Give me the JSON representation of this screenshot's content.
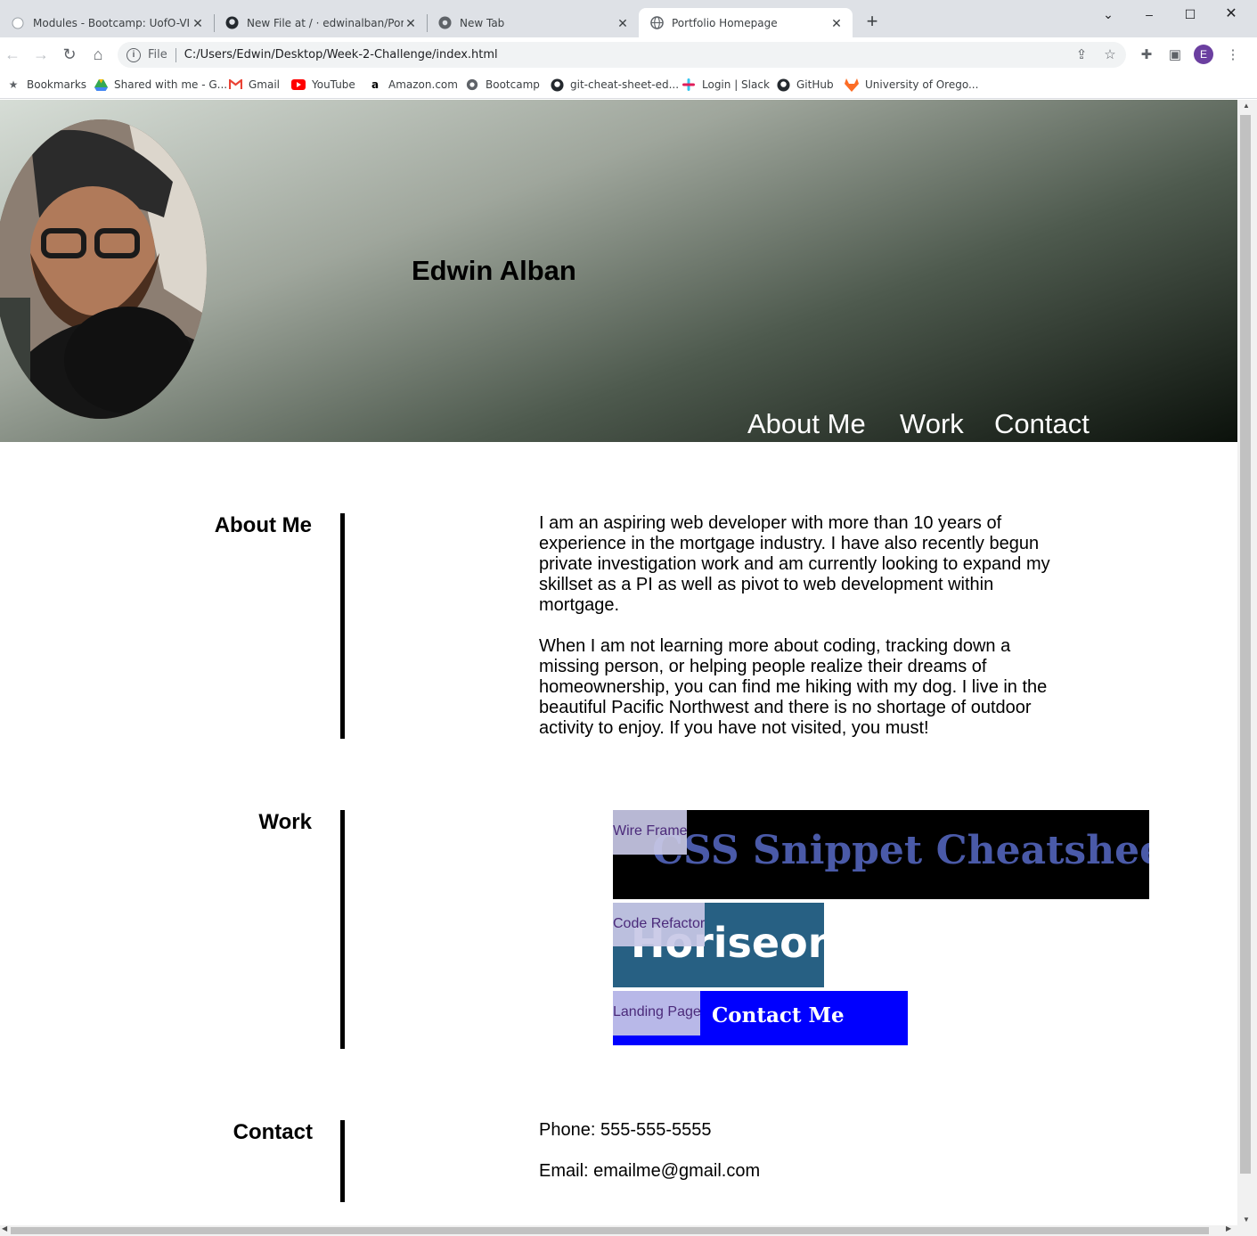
{
  "browser": {
    "tabs": [
      {
        "title": "Modules - Bootcamp: UofO-VIRT",
        "icon": "bootcamp-icon",
        "active": false
      },
      {
        "title": "New File at / · edwinalban/Portfo",
        "icon": "github-icon",
        "active": false
      },
      {
        "title": "New Tab",
        "icon": "chrome-icon",
        "active": false
      },
      {
        "title": "Portfolio Homepage",
        "icon": "globe-icon",
        "active": true
      }
    ],
    "address": {
      "scheme": "File",
      "url": "C:/Users/Edwin/Desktop/Week-2-Challenge/index.html"
    },
    "profile_initial": "E",
    "bookmarks": [
      {
        "label": "Bookmarks",
        "icon": "star-icon"
      },
      {
        "label": "Shared with me - G...",
        "icon": "google-drive-icon"
      },
      {
        "label": "Gmail",
        "icon": "gmail-icon"
      },
      {
        "label": "YouTube",
        "icon": "youtube-icon"
      },
      {
        "label": "Amazon.com",
        "icon": "amazon-icon"
      },
      {
        "label": "Bootcamp",
        "icon": "globe-icon"
      },
      {
        "label": "git-cheat-sheet-ed...",
        "icon": "github-icon"
      },
      {
        "label": "Login | Slack",
        "icon": "slack-icon"
      },
      {
        "label": "GitHub",
        "icon": "github-icon"
      },
      {
        "label": "University of Orego...",
        "icon": "gitlab-icon"
      }
    ]
  },
  "page": {
    "header": {
      "name": "Edwin Alban",
      "nav": [
        "About Me",
        "Work",
        "Contact"
      ]
    },
    "about": {
      "heading": "About Me",
      "paragraphs": [
        "I am an aspiring web developer with more than 10 years of experience in the mortgage industry. I have also recently begun private investigation work and am currently looking to expand my skillset as a PI as well as pivot to web development within mortgage.",
        "When I am not learning more about coding, tracking down a missing person, or helping people realize their dreams of homeownership, you can find me hiking with my dog. I live in the beautiful Pacific Northwest and there is no shortage of outdoor activity to enjoy. If you have not visited, you must!"
      ]
    },
    "work": {
      "heading": "Work",
      "projects": [
        {
          "label": "Wire Frame",
          "image_text": "CSS Snippet Cheatsheet",
          "bg": "#000000",
          "fg": "#4a5aa8"
        },
        {
          "label": "Code Refactor",
          "image_text": "Horiseon",
          "bg": "#276083",
          "fg": "#ffffff"
        },
        {
          "label": "Landing Page",
          "image_text": "Contact Me",
          "bg": "#0000ff",
          "fg": "#ffffff"
        }
      ]
    },
    "contact": {
      "heading": "Contact",
      "phone": "Phone: 555-555-5555",
      "email": "Email: emailme@gmail.com"
    }
  }
}
